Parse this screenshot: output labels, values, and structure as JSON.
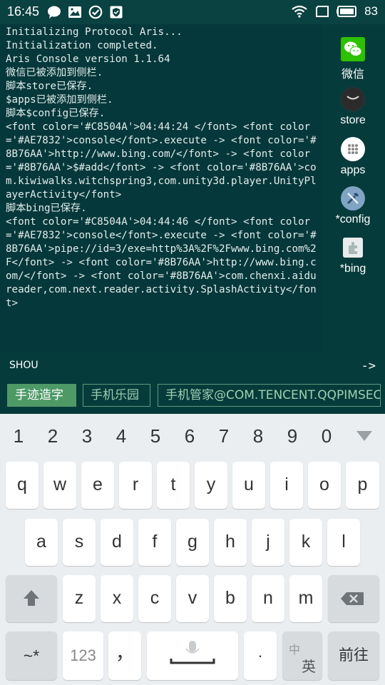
{
  "statusbar": {
    "time": "16:45",
    "battery": "83",
    "left_icons": [
      "chat-bubble-icon",
      "gallery-icon",
      "check-circle-icon",
      "shield-icon"
    ],
    "right_icons": [
      "wifi-icon",
      "screen-icon",
      "battery-icon"
    ]
  },
  "console": {
    "lines": [
      "Initializing Protocol Aris...",
      "",
      "Initialization completed.",
      "Aris Console version 1.1.64",
      "微信已被添加到侧栏.",
      "脚本store已保存.",
      "$apps已被添加到侧栏.",
      "脚本$config已保存.",
      "<font color='#C8504A'>04:44:24 </font> <font color='#AE7832'>console</font>.execute -> <font color='#8B76AA'>http://www.bing.com/</font> -> <font color='#8B76AA'>$#add</font> -> <font color='#8B76AA'>com.kiwiwalks.witchspring3,com.unity3d.player.UnityPlayerActivity</font>",
      "脚本bing已保存.",
      "<font color='#C8504A'>04:44:46 </font> <font color='#AE7832'>console</font>.execute -> <font color='#8B76AA'>pipe://id=3/exe=http%3A%2F%2Fwww.bing.com%2F</font> -> <font color='#8B76AA'>http://www.bing.com/</font> -> <font color='#8B76AA'>com.chenxi.aidureader,com.next.reader.activity.SplashActivity</font>"
    ]
  },
  "sidebar": {
    "items": [
      {
        "label": "微信",
        "icon": "wechat-icon"
      },
      {
        "label": "store",
        "icon": "store-icon"
      },
      {
        "label": "apps",
        "icon": "apps-icon"
      },
      {
        "label": "*config",
        "icon": "config-icon"
      },
      {
        "label": "*bing",
        "icon": "bing-icon"
      }
    ]
  },
  "input": {
    "value": "SHOU",
    "submit": "->"
  },
  "suggestions": [
    {
      "label": "手迹造字",
      "active": true
    },
    {
      "label": "手机乐园",
      "active": false
    },
    {
      "label": "手机管家@COM.TENCENT.QQPIMSECURE",
      "active": false
    }
  ],
  "keyboard": {
    "numbers": [
      "1",
      "2",
      "3",
      "4",
      "5",
      "6",
      "7",
      "8",
      "9",
      "0"
    ],
    "row1": [
      "q",
      "w",
      "e",
      "r",
      "t",
      "y",
      "u",
      "i",
      "o",
      "p"
    ],
    "row2": [
      "a",
      "s",
      "d",
      "f",
      "g",
      "h",
      "j",
      "k",
      "l"
    ],
    "row3": [
      "z",
      "x",
      "c",
      "v",
      "b",
      "n",
      "m"
    ],
    "symbols": "~*",
    "num_switch": "123",
    "comma": "，",
    "period": "·",
    "lang_top": "中",
    "lang_bottom": "英",
    "go": "前往"
  },
  "colors": {
    "console_bg": "#05383a",
    "time": "#C8504A",
    "console_word": "#AE7832",
    "link": "#8B76AA",
    "chip_active": "#4e9a67",
    "keyboard_bg": "#ebeef0"
  }
}
